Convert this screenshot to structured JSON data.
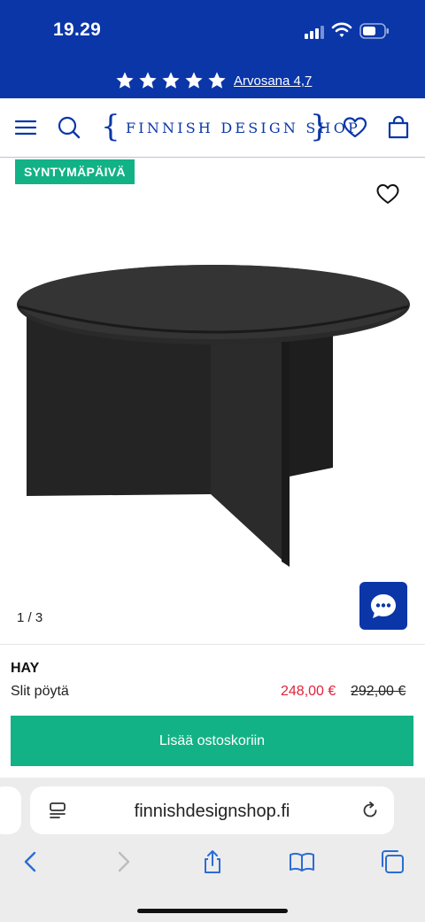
{
  "status_bar": {
    "time": "19.29"
  },
  "rating": {
    "stars": 5,
    "link_text": "Arvosana 4,7",
    "color": "#0a36a8"
  },
  "header": {
    "menu_icon": "hamburger-icon",
    "search_icon": "search-icon",
    "logo_text": "FINNISH DESIGN SHOP",
    "wishlist_icon": "heart-icon",
    "cart_icon": "shopping-bag-icon"
  },
  "gallery": {
    "badge": "SYNTYMÄPÄIVÄ",
    "counter": "1 / 3",
    "image_icon": "round-black-coffee-table",
    "chat_icon": "chat-bubble-icon"
  },
  "product": {
    "brand": "HAY",
    "name": "Slit pöytä",
    "price_current": "248,00 €",
    "price_original": "292,00 €",
    "add_to_cart": "Lisää ostoskoriin"
  },
  "browser": {
    "url": "finnishdesignshop.fi",
    "icons": [
      "back-icon",
      "forward-icon",
      "share-icon",
      "bookmarks-icon",
      "tabs-icon"
    ]
  },
  "colors": {
    "brand_blue": "#0a36a8",
    "accent_green": "#12b286",
    "sale_red": "#e0243a"
  }
}
